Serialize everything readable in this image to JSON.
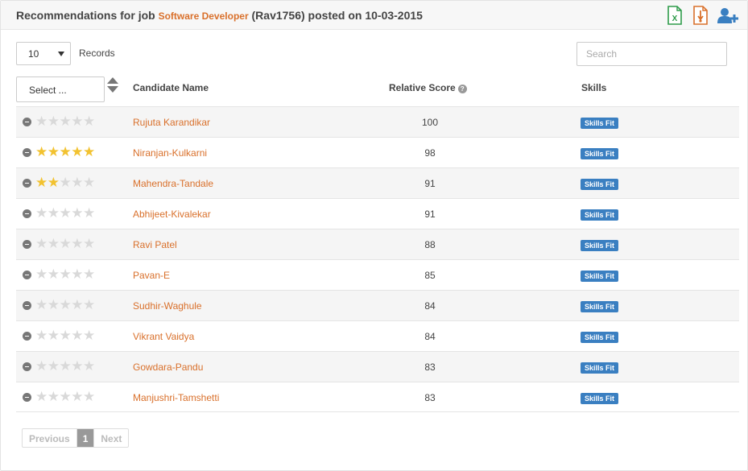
{
  "header": {
    "title_prefix": "Recommendations for job",
    "job_title": "Software Developer",
    "job_suffix": "(Rav1756) posted on 10-03-2015",
    "icons": [
      "excel-export-icon",
      "pdf-export-icon",
      "add-user-icon"
    ]
  },
  "controls": {
    "records_value": "10",
    "records_label": "Records",
    "search_placeholder": "Search",
    "select_value": "Select ..."
  },
  "table": {
    "columns": {
      "name": "Candidate Name",
      "score": "Relative Score",
      "skills": "Skills"
    },
    "skills_badge": "Skills Fit",
    "rows": [
      {
        "name": "Rujuta Karandikar",
        "score": "100",
        "rating": 0
      },
      {
        "name": "Niranjan-Kulkarni",
        "score": "98",
        "rating": 5
      },
      {
        "name": "Mahendra-Tandale",
        "score": "91",
        "rating": 2
      },
      {
        "name": "Abhijeet-Kivalekar",
        "score": "91",
        "rating": 0
      },
      {
        "name": "Ravi Patel",
        "score": "88",
        "rating": 0
      },
      {
        "name": "Pavan-E",
        "score": "85",
        "rating": 0
      },
      {
        "name": "Sudhir-Waghule",
        "score": "84",
        "rating": 0
      },
      {
        "name": "Vikrant Vaidya",
        "score": "84",
        "rating": 0
      },
      {
        "name": "Gowdara-Pandu",
        "score": "83",
        "rating": 0
      },
      {
        "name": "Manjushri-Tamshetti",
        "score": "83",
        "rating": 0
      }
    ]
  },
  "pagination": {
    "previous": "Previous",
    "current": "1",
    "next": "Next"
  },
  "colors": {
    "accent": "#d9702b",
    "badge": "#3a7fc1",
    "star_on": "#f2c230",
    "star_off": "#d9d9d9"
  }
}
